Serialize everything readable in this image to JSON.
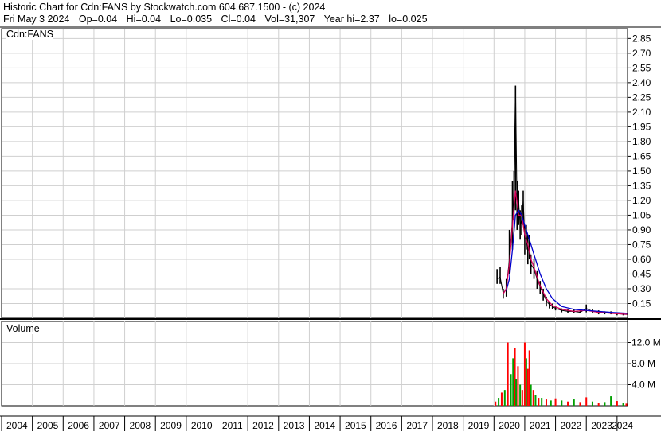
{
  "header": {
    "title": "Historic Chart for Cdn:FANS by Stockwatch.com 604.687.1500 - (c) 2024",
    "date": "Fri May  3 2024",
    "open": "Op=0.04",
    "high": "Hi=0.04",
    "low": "Lo=0.035",
    "close": "Cl=0.04",
    "volume": "Vol=31,307",
    "year_high": "Year hi=2.37",
    "year_low": "lo=0.025"
  },
  "chart_data": [
    {
      "type": "line",
      "panel": "price",
      "title": "Cdn:FANS",
      "ylim": [
        0,
        2.95
      ],
      "grid": true,
      "y_ticks": [
        "2.85",
        "2.70",
        "2.55",
        "2.40",
        "2.25",
        "2.10",
        "1.95",
        "1.80",
        "1.65",
        "1.50",
        "1.35",
        "1.20",
        "1.05",
        "0.90",
        "0.75",
        "0.60",
        "0.45",
        "0.30",
        "0.15"
      ],
      "series": [
        {
          "role": "price-bars",
          "color": "#000000",
          "x": [
            2020.1,
            2020.2,
            2020.3,
            2020.4,
            2020.5,
            2020.6,
            2020.65,
            2020.7,
            2020.75,
            2020.8,
            2020.85,
            2020.9,
            2020.95,
            2021.0,
            2021.05,
            2021.1,
            2021.15,
            2021.2,
            2021.3,
            2021.4,
            2021.5,
            2021.6,
            2021.7,
            2021.8,
            2021.9,
            2022.0,
            2022.2,
            2022.4,
            2022.6,
            2022.8,
            2023.0,
            2023.2,
            2023.4,
            2023.6,
            2023.8,
            2024.0,
            2024.2,
            2024.34
          ],
          "values": [
            0.4,
            0.42,
            0.25,
            0.3,
            0.6,
            1.0,
            1.3,
            2.37,
            1.1,
            1.2,
            0.95,
            1.0,
            1.2,
            0.8,
            0.85,
            0.7,
            0.75,
            0.55,
            0.5,
            0.4,
            0.32,
            0.25,
            0.18,
            0.14,
            0.12,
            0.1,
            0.08,
            0.07,
            0.07,
            0.06,
            0.1,
            0.07,
            0.06,
            0.06,
            0.05,
            0.05,
            0.04,
            0.04
          ],
          "highs": [
            0.5,
            0.52,
            0.3,
            0.4,
            0.9,
            1.4,
            1.5,
            2.37,
            1.4,
            1.3,
            1.1,
            1.15,
            1.3,
            0.95,
            0.95,
            0.85,
            0.85,
            0.65,
            0.6,
            0.48,
            0.38,
            0.3,
            0.22,
            0.17,
            0.15,
            0.12,
            0.1,
            0.09,
            0.09,
            0.08,
            0.14,
            0.09,
            0.08,
            0.07,
            0.07,
            0.06,
            0.05,
            0.04
          ],
          "lows": [
            0.35,
            0.35,
            0.2,
            0.22,
            0.45,
            0.7,
            1.0,
            1.1,
            0.9,
            0.95,
            0.8,
            0.85,
            0.95,
            0.65,
            0.7,
            0.55,
            0.6,
            0.45,
            0.4,
            0.3,
            0.25,
            0.18,
            0.12,
            0.1,
            0.09,
            0.08,
            0.06,
            0.05,
            0.05,
            0.05,
            0.06,
            0.05,
            0.04,
            0.04,
            0.04,
            0.03,
            0.03,
            0.035
          ]
        },
        {
          "name": "",
          "role": "moving-average-short",
          "color": "#d4005a",
          "x": [
            2020.3,
            2020.4,
            2020.5,
            2020.6,
            2020.7,
            2020.8,
            2020.9,
            2021.0,
            2021.1,
            2021.2,
            2021.3,
            2021.4,
            2021.5,
            2021.7,
            2021.9,
            2022.2,
            2022.6,
            2023.0,
            2023.4,
            2023.8,
            2024.34
          ],
          "values": [
            0.25,
            0.3,
            0.55,
            0.95,
            1.3,
            1.05,
            1.05,
            0.85,
            0.75,
            0.6,
            0.52,
            0.42,
            0.33,
            0.2,
            0.13,
            0.09,
            0.07,
            0.08,
            0.06,
            0.05,
            0.04
          ]
        },
        {
          "name": "",
          "role": "moving-average-long",
          "color": "#0000cc",
          "x": [
            2020.4,
            2020.5,
            2020.6,
            2020.7,
            2020.8,
            2020.9,
            2021.0,
            2021.1,
            2021.2,
            2021.3,
            2021.4,
            2021.5,
            2021.7,
            2021.9,
            2022.2,
            2022.6,
            2023.0,
            2023.4,
            2023.8,
            2024.34
          ],
          "values": [
            0.28,
            0.4,
            0.7,
            1.05,
            1.1,
            1.05,
            0.95,
            0.85,
            0.75,
            0.65,
            0.55,
            0.45,
            0.3,
            0.2,
            0.12,
            0.09,
            0.08,
            0.07,
            0.06,
            0.05
          ]
        }
      ]
    },
    {
      "type": "bar",
      "panel": "volume",
      "title": "Volume",
      "ylim": [
        0,
        16
      ],
      "grid": true,
      "y_ticks": [
        "12.0 M",
        "8.0 M",
        "4.0 M"
      ],
      "up_color": "#ff0000",
      "down_color": "#00a000",
      "x": [
        2020.05,
        2020.15,
        2020.25,
        2020.35,
        2020.45,
        2020.55,
        2020.62,
        2020.68,
        2020.72,
        2020.78,
        2020.85,
        2020.92,
        2021.0,
        2021.05,
        2021.1,
        2021.15,
        2021.2,
        2021.28,
        2021.35,
        2021.45,
        2021.55,
        2021.7,
        2021.85,
        2022.0,
        2022.2,
        2022.4,
        2022.6,
        2022.8,
        2023.0,
        2023.2,
        2023.4,
        2023.6,
        2023.8,
        2024.0,
        2024.2,
        2024.3
      ],
      "values": [
        0.8,
        1.5,
        2.5,
        3.0,
        12.0,
        6.0,
        9.0,
        11.0,
        5.0,
        7.5,
        4.0,
        3.0,
        12.0,
        9.0,
        7.0,
        10.5,
        4.0,
        3.0,
        2.0,
        1.5,
        1.5,
        1.2,
        1.0,
        1.4,
        1.0,
        0.8,
        1.2,
        0.7,
        1.6,
        0.8,
        0.6,
        0.7,
        1.8,
        0.9,
        0.6,
        0.4
      ],
      "directions": [
        "up",
        "down",
        "up",
        "down",
        "up",
        "down",
        "down",
        "up",
        "down",
        "up",
        "down",
        "up",
        "up",
        "down",
        "up",
        "up",
        "down",
        "up",
        "down",
        "up",
        "down",
        "up",
        "down",
        "up",
        "down",
        "up",
        "down",
        "up",
        "up",
        "down",
        "up",
        "down",
        "down",
        "up",
        "down",
        "up"
      ]
    }
  ],
  "x_axis": {
    "range": [
      2004,
      2024.34
    ],
    "labels": [
      "2004",
      "2005",
      "2006",
      "2007",
      "2008",
      "2009",
      "2010",
      "2011",
      "2012",
      "2013",
      "2014",
      "2015",
      "2016",
      "2017",
      "2018",
      "2019",
      "2020",
      "2021",
      "2022",
      "2023",
      "2024"
    ]
  }
}
